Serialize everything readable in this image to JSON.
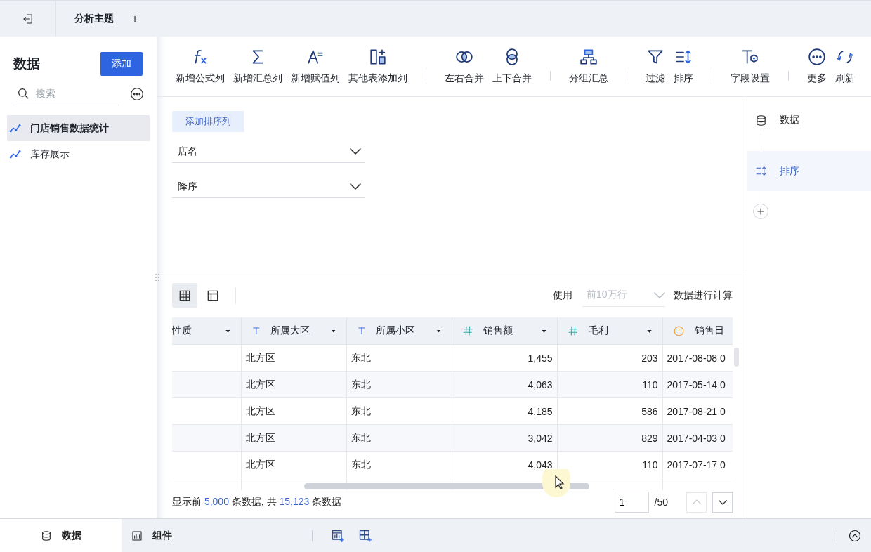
{
  "topbar": {
    "title": "分析主题"
  },
  "sidebar": {
    "title": "数据",
    "add_button": "添加",
    "search": {
      "placeholder": "搜索"
    },
    "items": [
      {
        "label": "门店销售数据统计",
        "selected": true
      },
      {
        "label": "库存展示",
        "selected": false
      }
    ]
  },
  "toolbar": {
    "groups": [
      {
        "items": [
          "新增公式列",
          "新增汇总列",
          "新增赋值列",
          "其他表添加列"
        ]
      },
      {
        "items": [
          "左右合并",
          "上下合并"
        ]
      },
      {
        "items": [
          "分组汇总"
        ]
      },
      {
        "items": [
          "过滤",
          "排序"
        ]
      },
      {
        "items": [
          "字段设置"
        ]
      },
      {
        "items": [
          "更多",
          "刷新"
        ]
      }
    ]
  },
  "sort": {
    "add_button": "添加排序列",
    "fields": [
      {
        "value": "店名"
      },
      {
        "value": "降序"
      }
    ]
  },
  "table_toolbar": {
    "views": [
      {
        "selected": true
      },
      {
        "selected": false
      }
    ],
    "use_label": "使用",
    "row_limit": {
      "placeholder": "前10万行",
      "disabled": true
    },
    "suffix": "数据进行计算"
  },
  "table": {
    "columns": [
      {
        "name": "性质"
      },
      {
        "name": "所属大区",
        "kind": "text"
      },
      {
        "name": "所属小区",
        "kind": "text"
      },
      {
        "name": "销售额",
        "kind": "number"
      },
      {
        "name": "毛利",
        "kind": "number"
      },
      {
        "name": "销售日",
        "kind": "date"
      }
    ],
    "rows": [
      {
        "cells": [
          "",
          "北方区",
          "东北",
          "1,455",
          "203",
          "2017-08-08 0"
        ]
      },
      {
        "cells": [
          "",
          "北方区",
          "东北",
          "4,063",
          "110",
          "2017-05-14 0"
        ]
      },
      {
        "cells": [
          "",
          "北方区",
          "东北",
          "4,185",
          "586",
          "2017-08-21 0"
        ]
      },
      {
        "cells": [
          "",
          "北方区",
          "东北",
          "3,042",
          "829",
          "2017-04-03 0"
        ]
      },
      {
        "cells": [
          "",
          "北方区",
          "东北",
          "4,043",
          "110",
          "2017-07-17 0"
        ]
      }
    ]
  },
  "footer": {
    "prefix": "显示前",
    "shown": "5,000",
    "middle": "条数据, 共",
    "total": "15,123",
    "suffix": "条数据"
  },
  "pager": {
    "value": "1",
    "total": "/50",
    "prev_disabled": true
  },
  "steps": [
    {
      "label": "数据",
      "selected": false
    },
    {
      "label": "排序",
      "selected": true
    }
  ],
  "bottom_tabs": [
    {
      "label": "数据",
      "selected": true
    },
    {
      "label": "组件",
      "selected": false
    }
  ]
}
